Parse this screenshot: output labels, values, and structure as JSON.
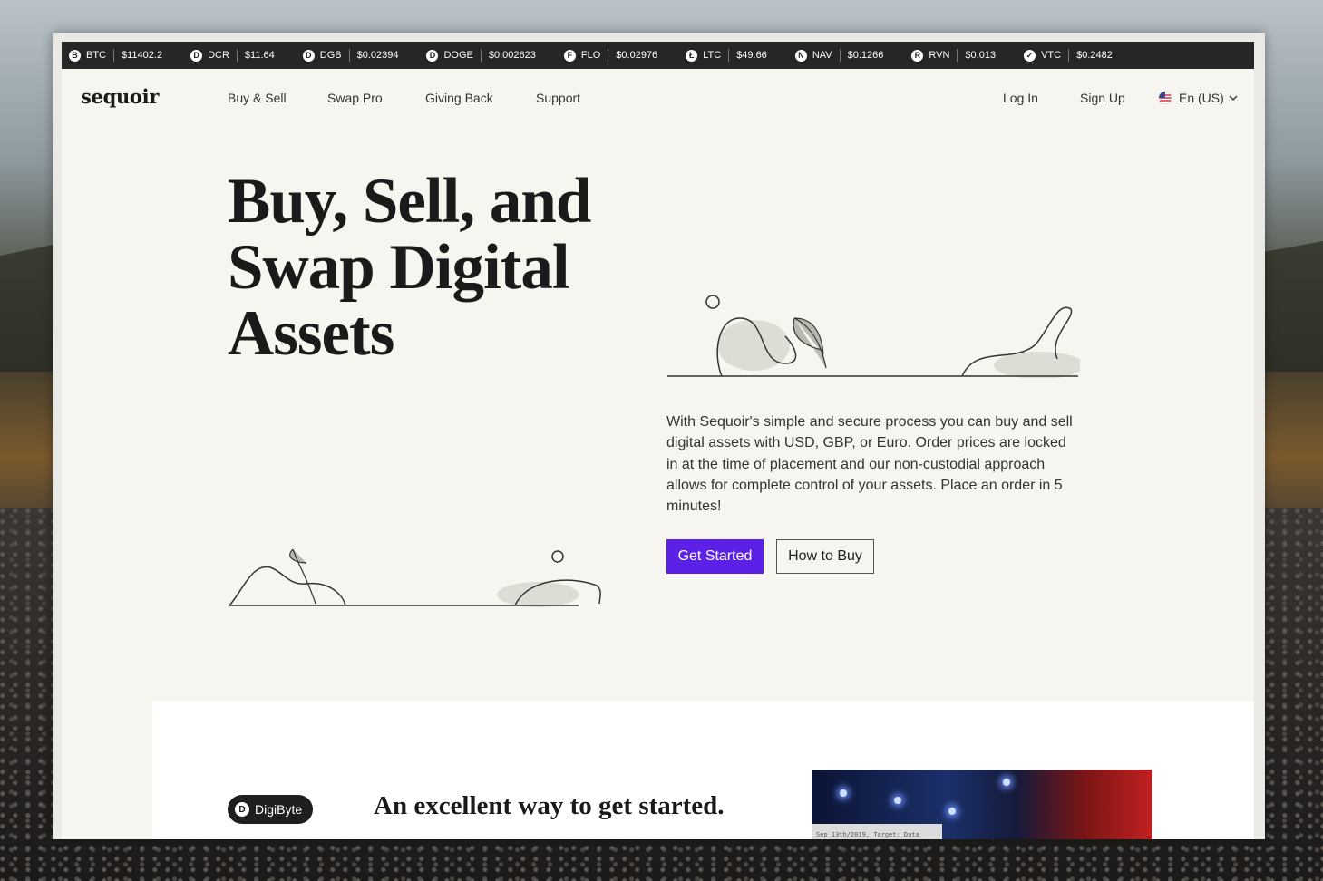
{
  "ticker": [
    {
      "icon": "btc-coin-icon",
      "glyph": "B",
      "symbol": "BTC",
      "price": "$11402.2"
    },
    {
      "icon": "dcr-coin-icon",
      "glyph": "D",
      "symbol": "DCR",
      "price": "$11.64"
    },
    {
      "icon": "dgb-coin-icon",
      "glyph": "D",
      "symbol": "DGB",
      "price": "$0.02394"
    },
    {
      "icon": "doge-coin-icon",
      "glyph": "D",
      "symbol": "DOGE",
      "price": "$0.002623"
    },
    {
      "icon": "flo-coin-icon",
      "glyph": "F",
      "symbol": "FLO",
      "price": "$0.02976"
    },
    {
      "icon": "ltc-coin-icon",
      "glyph": "Ł",
      "symbol": "LTC",
      "price": "$49.66"
    },
    {
      "icon": "nav-coin-icon",
      "glyph": "N",
      "symbol": "NAV",
      "price": "$0.1266"
    },
    {
      "icon": "rvn-coin-icon",
      "glyph": "R",
      "symbol": "RVN",
      "price": "$0.013"
    },
    {
      "icon": "vtc-coin-icon",
      "glyph": "✓",
      "symbol": "VTC",
      "price": "$0.2482"
    }
  ],
  "nav": {
    "logo": "sequoir",
    "links": [
      "Buy & Sell",
      "Swap Pro",
      "Giving Back",
      "Support"
    ],
    "login": "Log In",
    "signup": "Sign Up",
    "language": "En (US)"
  },
  "hero": {
    "title": "Buy, Sell, and Swap Digital Assets",
    "description": "With Sequoir's simple and secure process you can buy and sell digital assets with USD, GBP, or Euro. Order prices are locked in at the time of placement and our non-custodial approach allows for complete control of your assets. Place an order in 5 minutes!",
    "primary_button": "Get Started",
    "secondary_button": "How to Buy"
  },
  "section": {
    "badge": "DigiByte",
    "title": "An excellent way to get started.",
    "video_caption": "Sep 13th/2019, Target: Data"
  },
  "colors": {
    "accent": "#5b21e6",
    "ticker_bg": "#262626",
    "page_bg": "#f6f5ef"
  }
}
